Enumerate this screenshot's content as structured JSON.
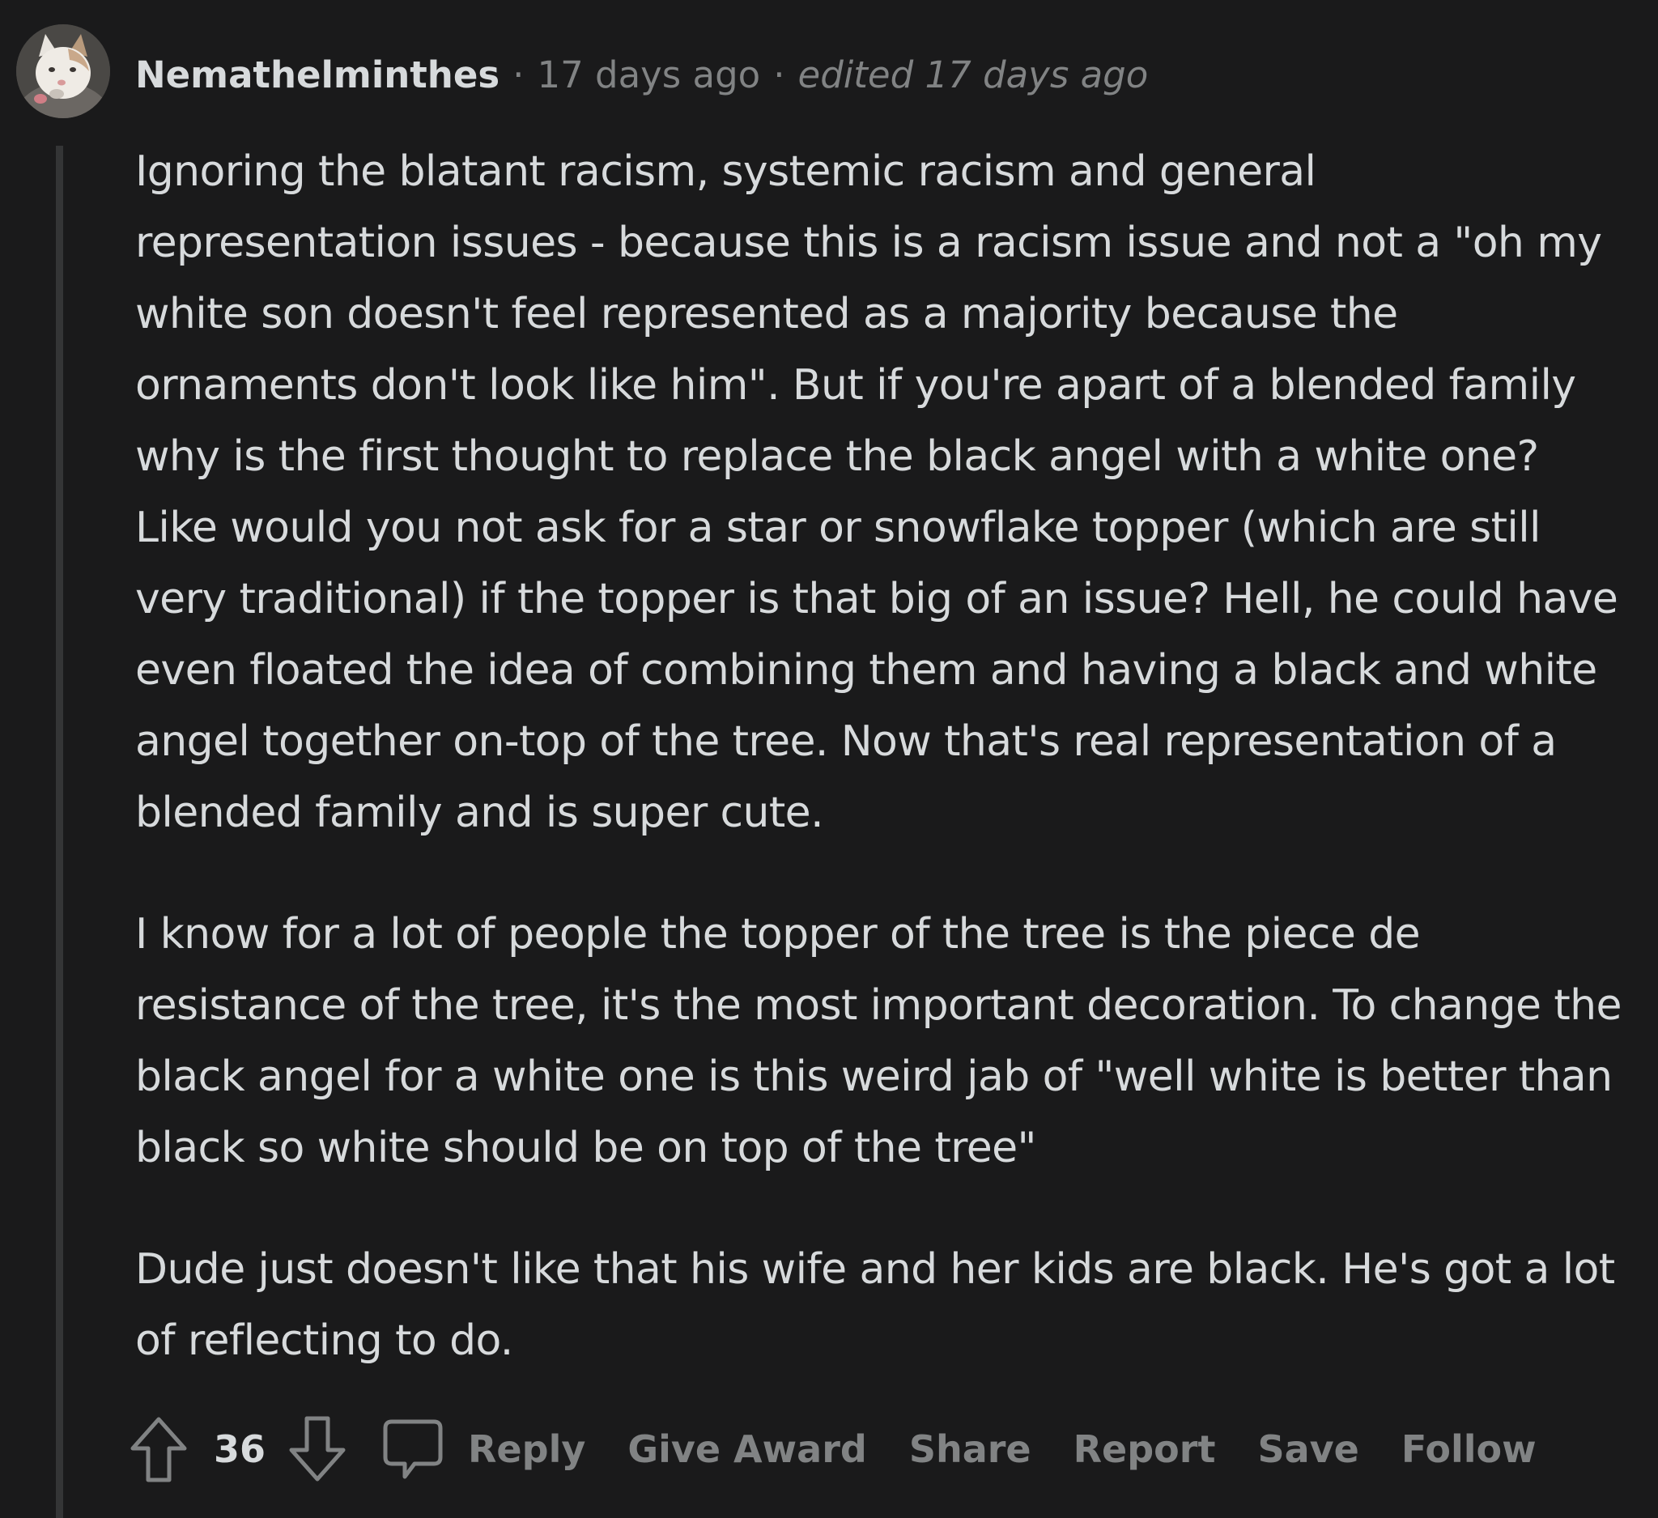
{
  "comment": {
    "author": "Nemathelminthes",
    "separator": "·",
    "timestamp": "17 days ago",
    "edited": "edited 17 days ago",
    "paragraphs": [
      "Ignoring the blatant racism, systemic racism and general representation issues - because this is a racism issue and not a \"oh my white son doesn't feel represented as a majority because the ornaments don't look like him\". But if you're apart of a blended family why is the first thought to replace the black angel with a white one? Like would you not ask for a star or snowflake topper (which are still very traditional) if the topper is that big of an issue? Hell, he could have even floated the idea of combining them and having a black and white angel together on-top of the tree. Now that's real representation of a blended family and is super cute.",
      "I know for a lot of people the topper of the tree is the piece de resistance of the tree, it's the most important decoration. To change the black angel for a white one is this weird jab of \"well white is better than black so white should be on top of the tree\"",
      "Dude just doesn't like that his wife and her kids are black. He's got a lot of reflecting to do."
    ],
    "vote_count": "36"
  },
  "actions": {
    "reply": "Reply",
    "give_award": "Give Award",
    "share": "Share",
    "report": "Report",
    "save": "Save",
    "follow": "Follow"
  },
  "icons": {
    "upvote": "upvote-arrow-icon",
    "downvote": "downvote-arrow-icon",
    "reply": "speech-bubble-icon",
    "avatar": "cat-avatar"
  },
  "colors": {
    "background": "#1a1a1b",
    "text": "#d7dadc",
    "muted": "#818384",
    "thread_line": "#343536"
  }
}
